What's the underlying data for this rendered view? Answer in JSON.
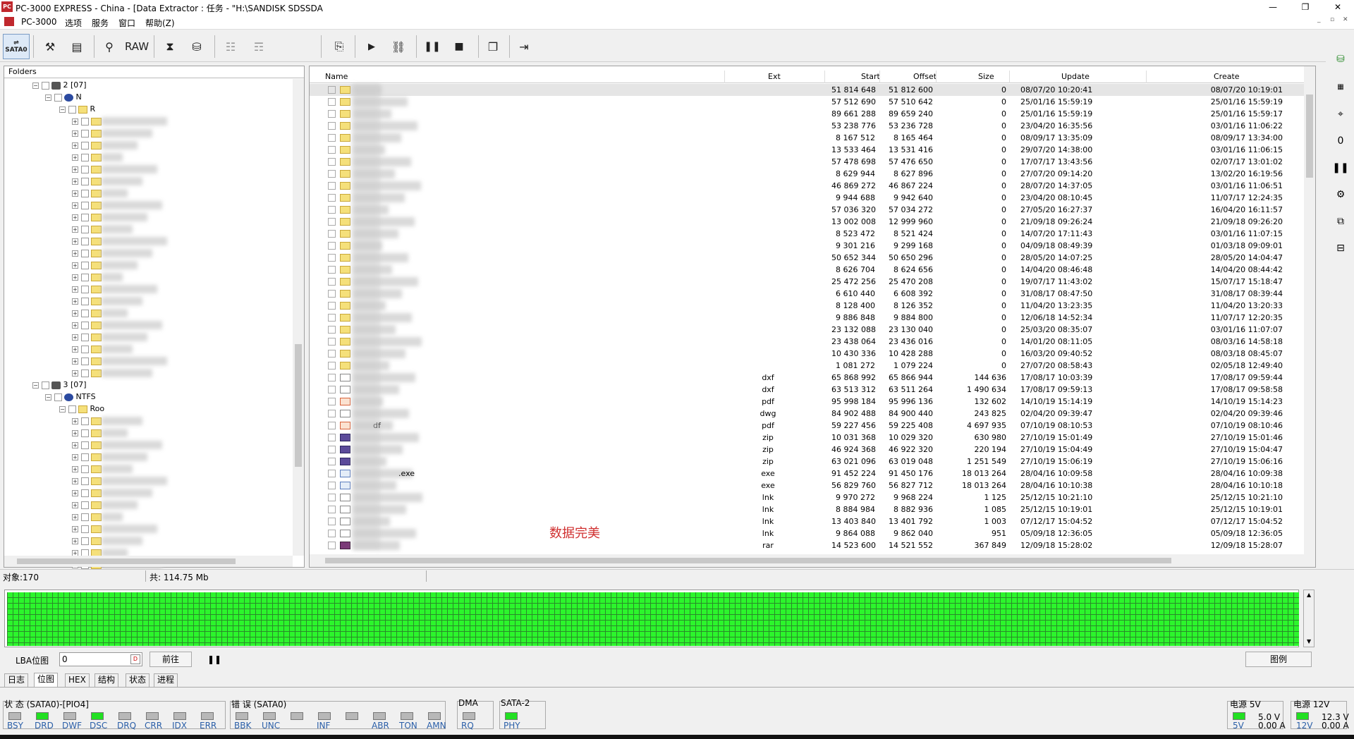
{
  "window": {
    "title": "PC-3000 EXPRESS - China - [Data Extractor : 任务 - \"H:\\SANDISK SDSSDA",
    "app_icon": "PC",
    "buttons": [
      "—",
      "❐",
      "✕"
    ]
  },
  "menu": {
    "items": [
      "PC-3000",
      "选项",
      "服务",
      "窗口",
      "帮助(Z)"
    ],
    "mdi_buttons": [
      "_",
      "▫",
      "✕"
    ]
  },
  "toolbar": {
    "sata_label": "SATA0",
    "raw_label": "RAW"
  },
  "left": {
    "header": "Folders",
    "nodes": [
      {
        "label": "2 [07]"
      },
      {
        "label": "N"
      },
      {
        "label": "R"
      },
      {
        "label": "3 [07]"
      },
      {
        "label": "NTFS"
      },
      {
        "label": "Roo"
      }
    ]
  },
  "table": {
    "columns": [
      "Name",
      "Ext",
      "Start",
      "Offset",
      "Size",
      "Update",
      "Create"
    ],
    "rows": [
      {
        "ext": "",
        "start": "51 814 648",
        "offset": "51 812 600",
        "size": "0",
        "update": "08/07/20 10:20:41",
        "create": "08/07/20 10:19:01",
        "icon": "folder"
      },
      {
        "ext": "",
        "start": "57 512 690",
        "offset": "57 510 642",
        "size": "0",
        "update": "25/01/16 15:59:19",
        "create": "25/01/16 15:59:19",
        "icon": "folder"
      },
      {
        "ext": "",
        "start": "89 661 288",
        "offset": "89 659 240",
        "size": "0",
        "update": "25/01/16 15:59:19",
        "create": "25/01/16 15:59:17",
        "icon": "folder"
      },
      {
        "ext": "",
        "start": "53 238 776",
        "offset": "53 236 728",
        "size": "0",
        "update": "23/04/20 16:35:56",
        "create": "03/01/16 11:06:22",
        "icon": "folder"
      },
      {
        "ext": "",
        "start": "8 167 512",
        "offset": "8 165 464",
        "size": "0",
        "update": "08/09/17 13:35:09",
        "create": "08/09/17 13:34:00",
        "icon": "folder"
      },
      {
        "ext": "",
        "start": "13 533 464",
        "offset": "13 531 416",
        "size": "0",
        "update": "29/07/20 14:38:00",
        "create": "03/01/16 11:06:15",
        "icon": "folder"
      },
      {
        "ext": "",
        "start": "57 478 698",
        "offset": "57 476 650",
        "size": "0",
        "update": "17/07/17 13:43:56",
        "create": "02/07/17 13:01:02",
        "icon": "folder"
      },
      {
        "ext": "",
        "start": "8 629 944",
        "offset": "8 627 896",
        "size": "0",
        "update": "27/07/20 09:14:20",
        "create": "13/02/20 16:19:56",
        "icon": "folder"
      },
      {
        "ext": "",
        "start": "46 869 272",
        "offset": "46 867 224",
        "size": "0",
        "update": "28/07/20 14:37:05",
        "create": "03/01/16 11:06:51",
        "icon": "folder"
      },
      {
        "ext": "",
        "start": "9 944 688",
        "offset": "9 942 640",
        "size": "0",
        "update": "23/04/20 08:10:45",
        "create": "11/07/17 12:24:35",
        "icon": "folder"
      },
      {
        "ext": "",
        "start": "57 036 320",
        "offset": "57 034 272",
        "size": "0",
        "update": "27/05/20 16:27:37",
        "create": "16/04/20 16:11:57",
        "icon": "folder"
      },
      {
        "ext": "",
        "start": "13 002 008",
        "offset": "12 999 960",
        "size": "0",
        "update": "21/09/18 09:26:24",
        "create": "21/09/18 09:26:20",
        "icon": "folder"
      },
      {
        "ext": "",
        "start": "8 523 472",
        "offset": "8 521 424",
        "size": "0",
        "update": "14/07/20 17:11:43",
        "create": "03/01/16 11:07:15",
        "icon": "folder"
      },
      {
        "ext": "",
        "start": "9 301 216",
        "offset": "9 299 168",
        "size": "0",
        "update": "04/09/18 08:49:39",
        "create": "01/03/18 09:09:01",
        "icon": "folder"
      },
      {
        "ext": "",
        "start": "50 652 344",
        "offset": "50 650 296",
        "size": "0",
        "update": "28/05/20 14:07:25",
        "create": "28/05/20 14:04:47",
        "icon": "folder"
      },
      {
        "ext": "",
        "start": "8 626 704",
        "offset": "8 624 656",
        "size": "0",
        "update": "14/04/20 08:46:48",
        "create": "14/04/20 08:44:42",
        "icon": "folder"
      },
      {
        "ext": "",
        "start": "25 472 256",
        "offset": "25 470 208",
        "size": "0",
        "update": "19/07/17 11:43:02",
        "create": "15/07/17 15:18:47",
        "icon": "folder"
      },
      {
        "ext": "",
        "start": "6 610 440",
        "offset": "6 608 392",
        "size": "0",
        "update": "31/08/17 08:47:50",
        "create": "31/08/17 08:39:44",
        "icon": "folder"
      },
      {
        "ext": "",
        "start": "8 128 400",
        "offset": "8 126 352",
        "size": "0",
        "update": "11/04/20 13:23:35",
        "create": "11/04/20 13:20:33",
        "icon": "folder"
      },
      {
        "ext": "",
        "start": "9 886 848",
        "offset": "9 884 800",
        "size": "0",
        "update": "12/06/18 14:52:34",
        "create": "11/07/17 12:20:35",
        "icon": "folder"
      },
      {
        "ext": "",
        "start": "23 132 088",
        "offset": "23 130 040",
        "size": "0",
        "update": "25/03/20 08:35:07",
        "create": "03/01/16 11:07:07",
        "icon": "folder"
      },
      {
        "ext": "",
        "start": "23 438 064",
        "offset": "23 436 016",
        "size": "0",
        "update": "14/01/20 08:11:05",
        "create": "08/03/16 14:58:18",
        "icon": "folder"
      },
      {
        "ext": "",
        "start": "10 430 336",
        "offset": "10 428 288",
        "size": "0",
        "update": "16/03/20 09:40:52",
        "create": "08/03/18 08:45:07",
        "icon": "folder"
      },
      {
        "ext": "",
        "start": "1 081 272",
        "offset": "1 079 224",
        "size": "0",
        "update": "27/07/20 08:58:43",
        "create": "02/05/18 12:49:40",
        "icon": "folder"
      },
      {
        "ext": "dxf",
        "start": "65 868 992",
        "offset": "65 866 944",
        "size": "144 636",
        "update": "17/08/17 10:03:39",
        "create": "17/08/17 09:59:44",
        "icon": "doc"
      },
      {
        "ext": "dxf",
        "start": "63 513 312",
        "offset": "63 511 264",
        "size": "1 490 634",
        "update": "17/08/17 09:59:13",
        "create": "17/08/17 09:58:58",
        "icon": "doc"
      },
      {
        "ext": "pdf",
        "start": "95 998 184",
        "offset": "95 996 136",
        "size": "132 602",
        "update": "14/10/19 15:14:19",
        "create": "14/10/19 15:14:23",
        "icon": "pdf"
      },
      {
        "ext": "dwg",
        "start": "84 902 488",
        "offset": "84 900 440",
        "size": "243 825",
        "update": "02/04/20 09:39:47",
        "create": "02/04/20 09:39:46",
        "icon": "doc"
      },
      {
        "ext": "pdf",
        "start": "59 227 456",
        "offset": "59 225 408",
        "size": "4 697 935",
        "update": "07/10/19 08:10:53",
        "create": "07/10/19 08:10:46",
        "icon": "pdf"
      },
      {
        "ext": "zip",
        "start": "10 031 368",
        "offset": "10 029 320",
        "size": "630 980",
        "update": "27/10/19 15:01:49",
        "create": "27/10/19 15:01:46",
        "icon": "zip"
      },
      {
        "ext": "zip",
        "start": "46 924 368",
        "offset": "46 922 320",
        "size": "220 194",
        "update": "27/10/19 15:04:49",
        "create": "27/10/19 15:04:47",
        "icon": "zip"
      },
      {
        "ext": "zip",
        "start": "63 021 096",
        "offset": "63 019 048",
        "size": "1 251 549",
        "update": "27/10/19 15:06:19",
        "create": "27/10/19 15:06:16",
        "icon": "zip"
      },
      {
        "ext": "exe",
        "start": "91 452 224",
        "offset": "91 450 176",
        "size": "18 013 264",
        "update": "28/04/16 10:09:58",
        "create": "28/04/16 10:09:38",
        "icon": "exe"
      },
      {
        "ext": "exe",
        "start": "56 829 760",
        "offset": "56 827 712",
        "size": "18 013 264",
        "update": "28/04/16 10:10:38",
        "create": "28/04/16 10:10:18",
        "icon": "exe"
      },
      {
        "ext": "lnk",
        "start": "9 970 272",
        "offset": "9 968 224",
        "size": "1 125",
        "update": "25/12/15 10:21:10",
        "create": "25/12/15 10:21:10",
        "icon": "doc"
      },
      {
        "ext": "lnk",
        "start": "8 884 984",
        "offset": "8 882 936",
        "size": "1 085",
        "update": "25/12/15 10:19:01",
        "create": "25/12/15 10:19:01",
        "icon": "doc"
      },
      {
        "ext": "lnk",
        "start": "13 403 840",
        "offset": "13 401 792",
        "size": "1 003",
        "update": "07/12/17 15:04:52",
        "create": "07/12/17 15:04:52",
        "icon": "doc"
      },
      {
        "ext": "lnk",
        "start": "9 864 088",
        "offset": "9 862 040",
        "size": "951",
        "update": "05/09/18 12:36:05",
        "create": "05/09/18 12:36:05",
        "icon": "doc"
      },
      {
        "ext": "rar",
        "start": "14 523 600",
        "offset": "14 521 552",
        "size": "367 849",
        "update": "12/09/18 15:28:02",
        "create": "12/09/18 15:28:07",
        "icon": "rar"
      }
    ],
    "name_fragments": [
      ".exe",
      "df"
    ],
    "watermark": "数据完美"
  },
  "status": {
    "objects": "对象:170",
    "total": "共:  114.75 Mb"
  },
  "lba": {
    "label": "LBA位图",
    "value": "0",
    "go": "前往",
    "legend": "图例"
  },
  "tabs": [
    "日志",
    "位图",
    "HEX",
    "结构",
    "状态",
    "进程"
  ],
  "indicators": {
    "state_title": "状 态 (SATA0)-[PIO4]",
    "state": [
      {
        "n": "BSY",
        "on": false
      },
      {
        "n": "DRD",
        "on": true
      },
      {
        "n": "DWF",
        "on": false
      },
      {
        "n": "DSC",
        "on": true
      },
      {
        "n": "DRQ",
        "on": false
      },
      {
        "n": "CRR",
        "on": false
      },
      {
        "n": "IDX",
        "on": false
      },
      {
        "n": "ERR",
        "on": false
      }
    ],
    "error_title": "错 误 (SATA0)",
    "error": [
      {
        "n": "BBK",
        "on": false
      },
      {
        "n": "UNC",
        "on": false
      },
      {
        "n": "",
        "on": false
      },
      {
        "n": "INF",
        "on": false
      },
      {
        "n": "",
        "on": false
      },
      {
        "n": "ABR",
        "on": false
      },
      {
        "n": "TON",
        "on": false
      },
      {
        "n": "AMN",
        "on": false
      }
    ],
    "dma_title": "DMA",
    "dma": [
      {
        "n": "RQ",
        "on": false
      }
    ],
    "sata2_title": "SATA-2",
    "sata2": [
      {
        "n": "PHY",
        "on": true
      }
    ],
    "power5": {
      "title": "电源 5V",
      "led": "5V",
      "v": "5.0 V",
      "a": "0.00 A"
    },
    "power12": {
      "title": "电源 12V",
      "led": "12V",
      "v": "12.3 V",
      "a": "0.00 A"
    }
  }
}
